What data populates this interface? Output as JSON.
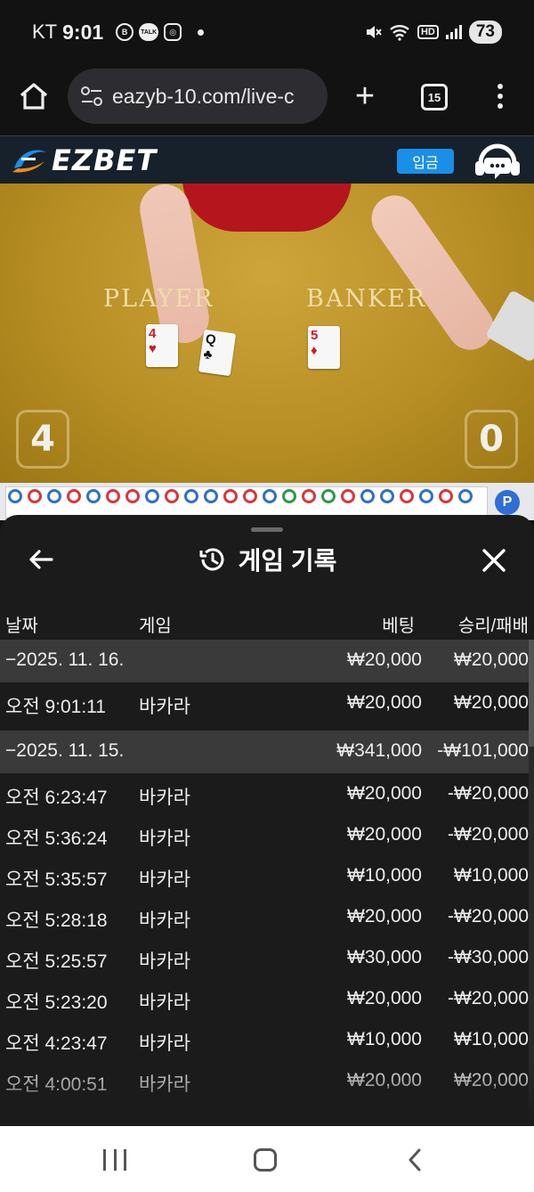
{
  "status_bar": {
    "carrier": "KT",
    "time": "9:01",
    "hd_label": "HD",
    "battery": "73"
  },
  "browser": {
    "url": "eazyb-10.com/live-c",
    "tab_count": "15"
  },
  "site": {
    "logo_text": "EZBET",
    "deposit_label": "입금",
    "brand_color": "#1a8fe8"
  },
  "video": {
    "player_label": "PLAYER",
    "banker_label": "BANKER",
    "player_score": "4",
    "banker_score": "0",
    "player_cards": [
      {
        "rank": "4",
        "suit": "♥",
        "color": "red"
      },
      {
        "rank": "Q",
        "suit": "♣",
        "color": "black"
      }
    ],
    "banker_cards": [
      {
        "rank": "5",
        "suit": "♦",
        "color": "red"
      }
    ]
  },
  "roadmap": {
    "toggle_label": "P"
  },
  "sheet": {
    "title": "게임 기록",
    "columns": {
      "date": "날짜",
      "game": "게임",
      "bet": "베팅",
      "result": "승리/패배"
    },
    "rows": [
      {
        "type": "date",
        "date": "−2025. 11. 16.",
        "game": "",
        "bet": "₩20,000",
        "result": "₩20,000"
      },
      {
        "type": "entry",
        "date": "오전 9:01:11",
        "game": "바카라",
        "bet": "₩20,000",
        "result": "₩20,000"
      },
      {
        "type": "date",
        "date": "−2025. 11. 15.",
        "game": "",
        "bet": "₩341,000",
        "result": "-₩101,000"
      },
      {
        "type": "entry",
        "date": "오전 6:23:47",
        "game": "바카라",
        "bet": "₩20,000",
        "result": "-₩20,000"
      },
      {
        "type": "entry",
        "date": "오전 5:36:24",
        "game": "바카라",
        "bet": "₩20,000",
        "result": "-₩20,000"
      },
      {
        "type": "entry",
        "date": "오전 5:35:57",
        "game": "바카라",
        "bet": "₩10,000",
        "result": "₩10,000"
      },
      {
        "type": "entry",
        "date": "오전 5:28:18",
        "game": "바카라",
        "bet": "₩20,000",
        "result": "-₩20,000"
      },
      {
        "type": "entry",
        "date": "오전 5:25:57",
        "game": "바카라",
        "bet": "₩30,000",
        "result": "-₩30,000"
      },
      {
        "type": "entry",
        "date": "오전 5:23:20",
        "game": "바카라",
        "bet": "₩20,000",
        "result": "-₩20,000"
      },
      {
        "type": "entry",
        "date": "오전 4:23:47",
        "game": "바카라",
        "bet": "₩10,000",
        "result": "₩10,000"
      },
      {
        "type": "entry",
        "date": "오전 4:00:51",
        "game": "바카라",
        "bet": "₩20,000",
        "result": "₩20,000"
      }
    ]
  },
  "colors": {
    "player_bead": "#2f6fd1",
    "banker_bead": "#d9363e",
    "tie_bead": "#2e9a45"
  }
}
